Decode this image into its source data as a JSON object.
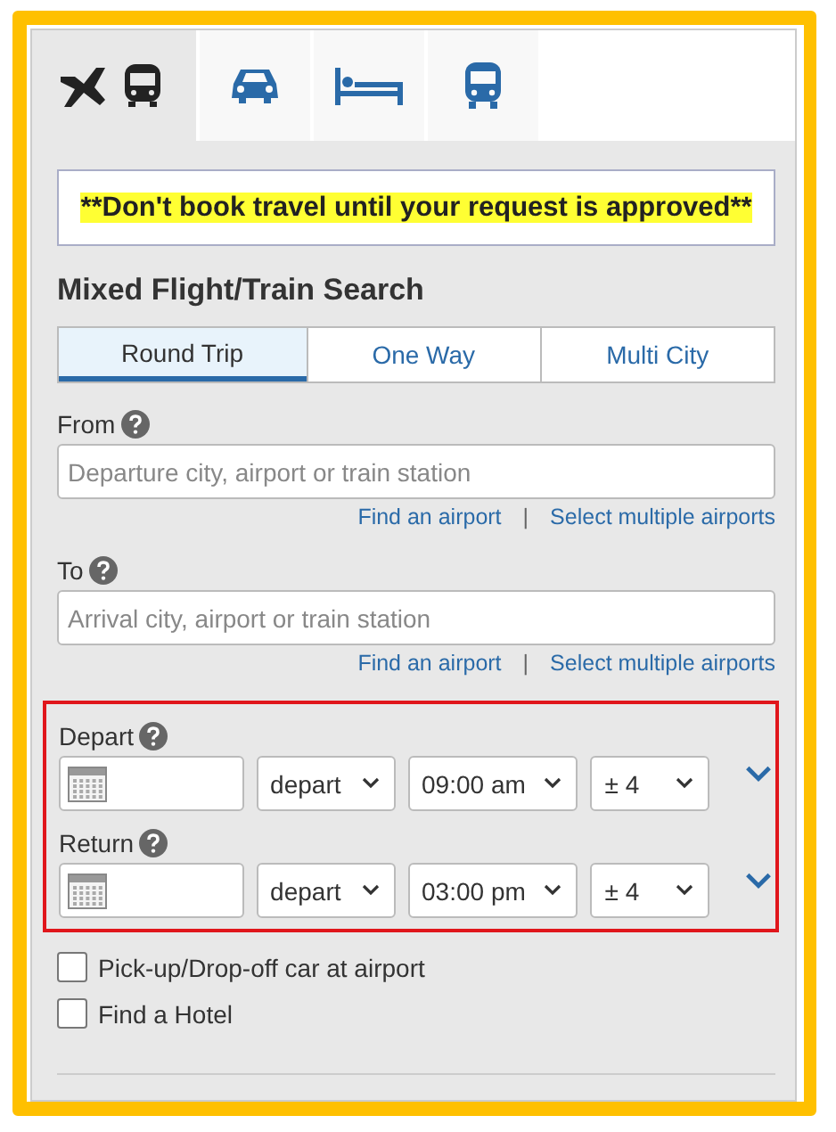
{
  "tabs": [
    {
      "kind": "flight-train",
      "selected": true
    },
    {
      "kind": "car",
      "selected": false
    },
    {
      "kind": "hotel",
      "selected": false
    },
    {
      "kind": "train",
      "selected": false
    }
  ],
  "notice": "**Don't book travel until your request is approved**",
  "heading": "Mixed Flight/Train Search",
  "trip_types": [
    {
      "label": "Round Trip",
      "selected": true
    },
    {
      "label": "One Way",
      "selected": false
    },
    {
      "label": "Multi City",
      "selected": false
    }
  ],
  "locations": [
    {
      "label": "From",
      "placeholder": "Departure city, airport or train station",
      "links": [
        "Find an airport",
        "Select multiple airports"
      ],
      "separator": "|"
    },
    {
      "label": "To",
      "placeholder": "Arrival city, airport or train station",
      "links": [
        "Find an airport",
        "Select multiple airports"
      ],
      "separator": "|"
    }
  ],
  "dates": [
    {
      "label": "Depart",
      "mode": "depart",
      "time": "09:00 am",
      "range": "± 4"
    },
    {
      "label": "Return",
      "mode": "depart",
      "time": "03:00 pm",
      "range": "± 4"
    }
  ],
  "options": [
    {
      "label": "Pick-up/Drop-off car at airport",
      "checked": false
    },
    {
      "label": "Find a Hotel",
      "checked": false
    }
  ]
}
